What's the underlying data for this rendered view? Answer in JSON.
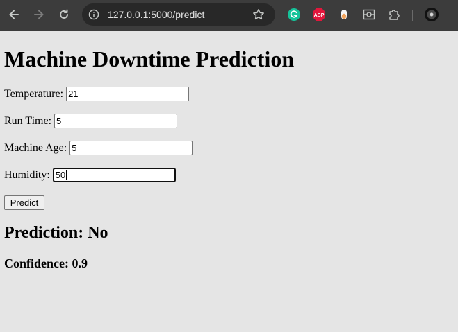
{
  "browser": {
    "url": "127.0.0.1:5000/predict",
    "nav_icons": [
      "arrow-left-icon",
      "arrow-right-icon",
      "reload-icon"
    ],
    "extensions": [
      {
        "name": "grammarly",
        "color": "#15c39a",
        "text": "G"
      },
      {
        "name": "adblock-plus",
        "color": "#e1173c",
        "text": "ABP"
      },
      {
        "name": "drop",
        "color": "#f2a35b"
      },
      {
        "name": "screen-capture"
      },
      {
        "name": "extensions-puzzle"
      }
    ]
  },
  "page": {
    "title": "Machine Downtime Prediction",
    "fields": {
      "temperature": {
        "label": "Temperature:",
        "value": "21"
      },
      "run_time": {
        "label": "Run Time:",
        "value": "5"
      },
      "machine_age": {
        "label": "Machine Age:",
        "value": "5"
      },
      "humidity": {
        "label": "Humidity:",
        "value": "50"
      }
    },
    "predict_label": "Predict",
    "prediction": "Prediction: No",
    "confidence": "Confidence: 0.9"
  }
}
